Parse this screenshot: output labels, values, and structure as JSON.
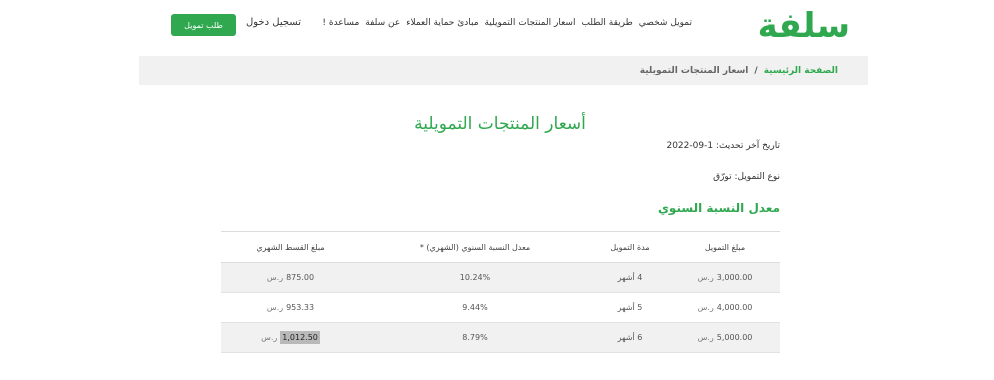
{
  "header": {
    "logo_text": "سلفة",
    "nav": [
      "تمويل شخصي",
      "طريقة الطلب",
      "اسعار المنتجات التمويلية",
      "مبادئ حماية العملاء",
      "عن سلفة",
      "مساعدة !"
    ],
    "login_label": "تسجيل دخول",
    "apply_label": "طلب تمويل",
    "brand_color": "#2fa84f"
  },
  "breadcrumb": {
    "home": "الصفحة الرئيسية",
    "separator": "/",
    "current": "اسعار المنتجات التمويلية"
  },
  "main": {
    "title": "أسعار المنتجات التمويلية",
    "updated": "تاريخ آخر تحديث: 1-09-2022",
    "finance_type": "نوع التمويل: تورّق",
    "section_title": "معدل النسبة السنوي"
  },
  "table": {
    "headers": [
      "مبلغ التمويل",
      "مدة التمويل",
      "معدل النسبة السنوي (الشهري) *",
      "مبلغ القسط الشهري"
    ],
    "currency": "ر.س",
    "rows": [
      {
        "amount": "3,000.00",
        "duration": "4 أشهر",
        "rate": "10.24%",
        "installment": "875.00"
      },
      {
        "amount": "4,000.00",
        "duration": "5 أشهر",
        "rate": "9.44%",
        "installment": "953.33"
      },
      {
        "amount": "5,000.00",
        "duration": "6 أشهر",
        "rate": "8.79%",
        "installment": "1,012.50"
      }
    ]
  }
}
